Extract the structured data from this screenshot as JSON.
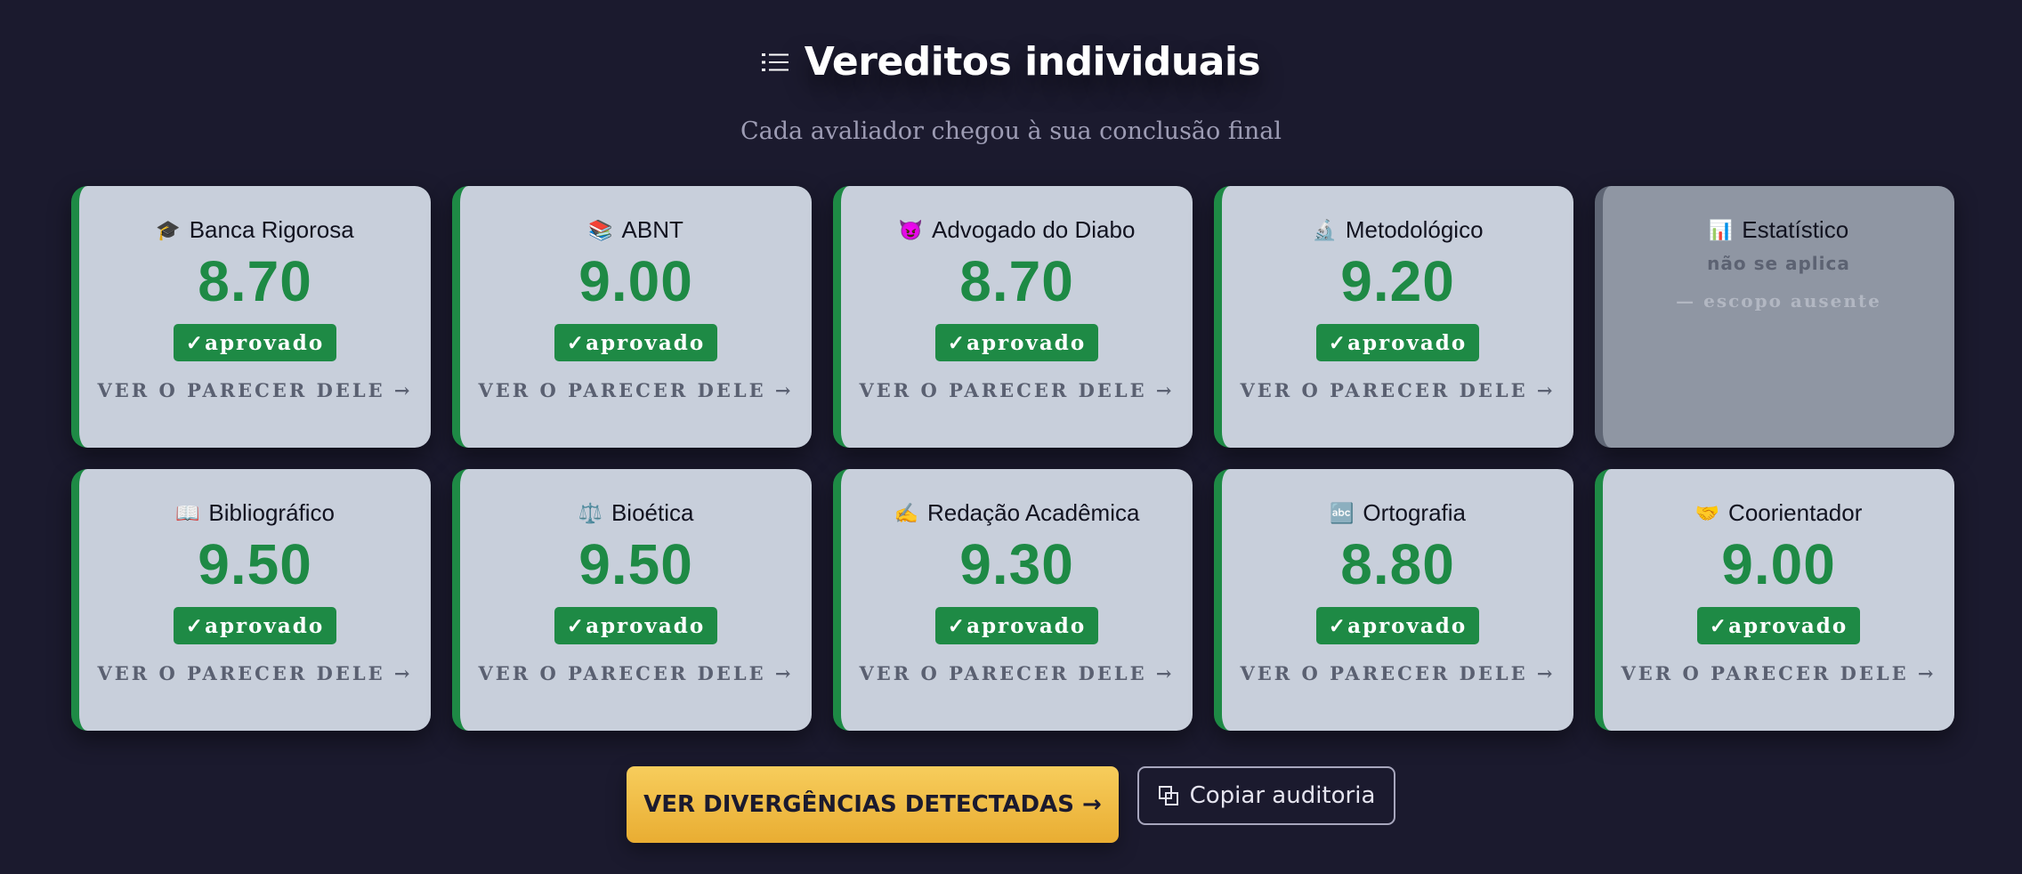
{
  "header": {
    "icon": "list-icon",
    "title": "Vereditos individuais",
    "subtitle": "Cada avaliador chegou à sua conclusão final"
  },
  "colors": {
    "background": "#1b1a2e",
    "card": "#c8cfdb",
    "approved": "#1e8a45",
    "not_applicable_card": "#8f96a3",
    "primary_button": "#f2c14c"
  },
  "cards": [
    {
      "emoji": "🎓",
      "icon": "graduation-cap-icon",
      "name": "Banca Rigorosa",
      "score": "8.70",
      "status": "✓aprovado",
      "link": "VER O PARECER DELE →"
    },
    {
      "emoji": "📚",
      "icon": "books-icon",
      "name": "ABNT",
      "score": "9.00",
      "status": "✓aprovado",
      "link": "VER O PARECER DELE →"
    },
    {
      "emoji": "😈",
      "icon": "devil-face-icon",
      "name": "Advogado do Diabo",
      "score": "8.70",
      "status": "✓aprovado",
      "link": "VER O PARECER DELE →"
    },
    {
      "emoji": "🔬",
      "icon": "microscope-icon",
      "name": "Metodológico",
      "score": "9.20",
      "status": "✓aprovado",
      "link": "VER O PARECER DELE →"
    },
    {
      "emoji": "📊",
      "icon": "bar-chart-icon",
      "name": "Estatístico",
      "not_applicable": "não se aplica",
      "reason": "— escopo ausente"
    },
    {
      "emoji": "📖",
      "icon": "open-book-icon",
      "name": "Bibliográfico",
      "score": "9.50",
      "status": "✓aprovado",
      "link": "VER O PARECER DELE →"
    },
    {
      "emoji": "⚖️",
      "icon": "scales-icon",
      "name": "Bioética",
      "score": "9.50",
      "status": "✓aprovado",
      "link": "VER O PARECER DELE →"
    },
    {
      "emoji": "✍️",
      "icon": "writing-hand-icon",
      "name": "Redação Acadêmica",
      "score": "9.30",
      "status": "✓aprovado",
      "link": "VER O PARECER DELE →"
    },
    {
      "emoji": "🔤",
      "icon": "abc-icon",
      "name": "Ortografia",
      "score": "8.80",
      "status": "✓aprovado",
      "link": "VER O PARECER DELE →"
    },
    {
      "emoji": "🤝",
      "icon": "handshake-icon",
      "name": "Coorientador",
      "score": "9.00",
      "status": "✓aprovado",
      "link": "VER O PARECER DELE →"
    }
  ],
  "actions": {
    "primary_label": "VER DIVERGÊNCIAS DETECTADAS →",
    "secondary_icon": "copy-icon",
    "secondary_label": "Copiar auditoria"
  }
}
